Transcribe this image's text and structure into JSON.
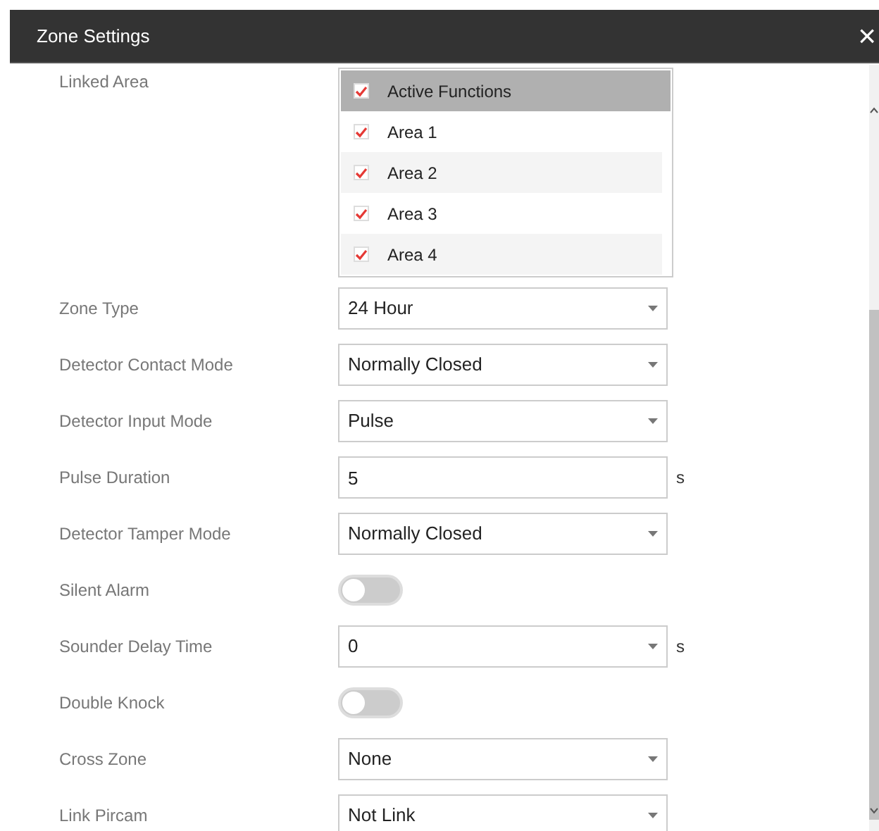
{
  "dialog": {
    "title": "Zone Settings",
    "close": "×"
  },
  "linked_area": {
    "label": "Linked Area",
    "items": [
      {
        "label": "Active Functions",
        "checked": true,
        "header": true,
        "striped": false
      },
      {
        "label": "Area 1",
        "checked": true,
        "header": false,
        "striped": false
      },
      {
        "label": "Area 2",
        "checked": true,
        "header": false,
        "striped": true
      },
      {
        "label": "Area 3",
        "checked": true,
        "header": false,
        "striped": false
      },
      {
        "label": "Area 4",
        "checked": true,
        "header": false,
        "striped": true
      }
    ]
  },
  "fields": [
    {
      "kind": "select",
      "label": "Zone Type",
      "value": "24 Hour"
    },
    {
      "kind": "select",
      "label": "Detector Contact Mode",
      "value": "Normally Closed"
    },
    {
      "kind": "select",
      "label": "Detector Input Mode",
      "value": "Pulse"
    },
    {
      "kind": "text",
      "label": "Pulse Duration",
      "value": "5",
      "unit": "s"
    },
    {
      "kind": "select",
      "label": "Detector Tamper Mode",
      "value": "Normally Closed"
    },
    {
      "kind": "toggle",
      "label": "Silent Alarm",
      "on": false
    },
    {
      "kind": "select",
      "label": "Sounder Delay Time",
      "value": "0",
      "unit": "s"
    },
    {
      "kind": "toggle",
      "label": "Double Knock",
      "on": false
    },
    {
      "kind": "select",
      "label": "Cross Zone",
      "value": "None"
    },
    {
      "kind": "select",
      "label": "Link Pircam",
      "value": "Not Link"
    }
  ]
}
